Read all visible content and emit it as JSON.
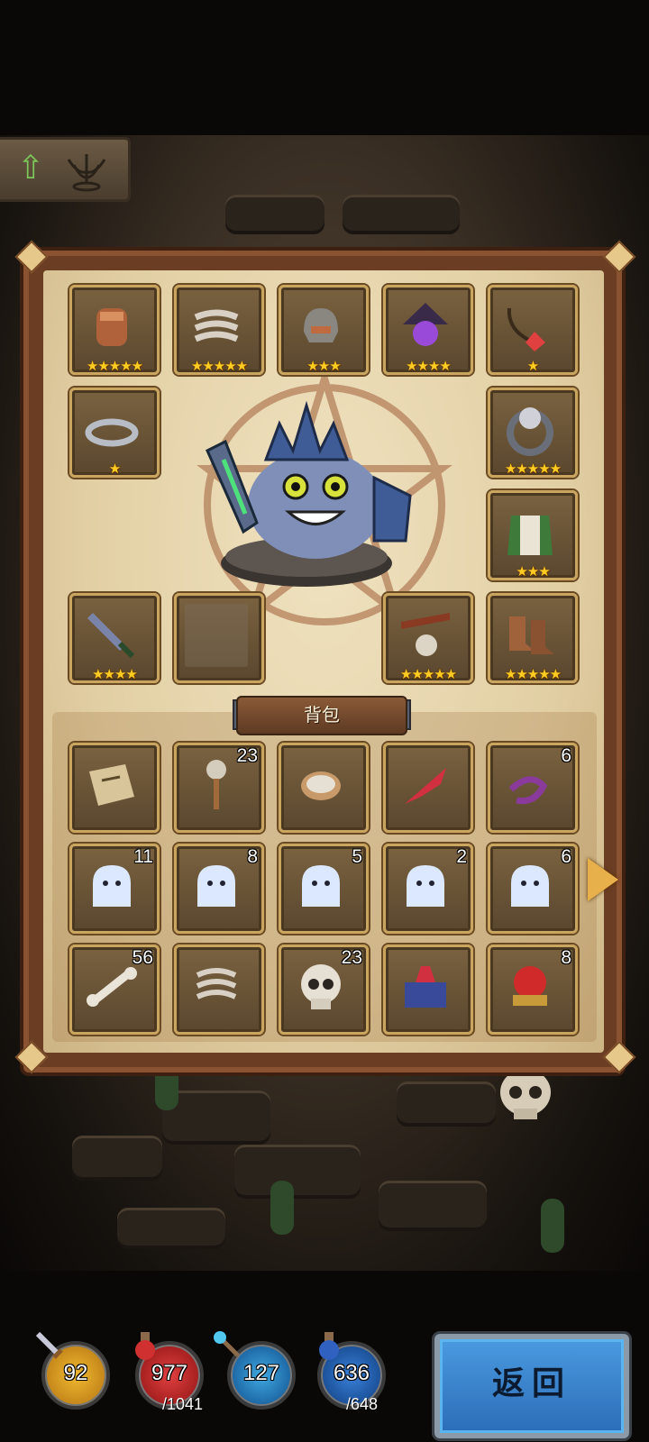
{
  "bag": {
    "title": "背包"
  },
  "equipment": [
    {
      "id": "gauntlet",
      "icon": "gauntlet-icon",
      "stars": 5
    },
    {
      "id": "bone-armor",
      "icon": "bone-armor-icon",
      "stars": 5
    },
    {
      "id": "bone-helm",
      "icon": "bone-helmet-icon",
      "stars": 3
    },
    {
      "id": "dark-lantern",
      "icon": "dark-lantern-icon",
      "stars": 4
    },
    {
      "id": "gem-necklace",
      "icon": "necklace-icon",
      "stars": 1
    },
    {
      "id": "silver-ring",
      "icon": "ring-icon",
      "stars": 1
    },
    {
      "id": "skull-ring",
      "icon": "skull-ring-icon",
      "stars": 5
    },
    {
      "id": "green-cloak",
      "icon": "cloak-icon",
      "stars": 3
    },
    {
      "id": "dagger",
      "icon": "dagger-icon",
      "stars": 4
    },
    {
      "id": "empty",
      "icon": "empty-slot-icon",
      "stars": 0
    },
    {
      "id": "skull-belt",
      "icon": "skull-belt-icon",
      "stars": 5
    },
    {
      "id": "boots",
      "icon": "boots-icon",
      "stars": 5
    }
  ],
  "inventory": [
    {
      "icon": "map-scroll-icon",
      "count": ""
    },
    {
      "icon": "skull-key-icon",
      "count": "23"
    },
    {
      "icon": "compass-icon",
      "count": ""
    },
    {
      "icon": "red-feather-icon",
      "count": ""
    },
    {
      "icon": "purple-rope-icon",
      "count": "6"
    },
    {
      "icon": "ghost-icon",
      "count": "11"
    },
    {
      "icon": "ghost-icon",
      "count": "8"
    },
    {
      "icon": "ghost-icon",
      "count": "5"
    },
    {
      "icon": "ghost-icon",
      "count": "2"
    },
    {
      "icon": "ghost-icon",
      "count": "6"
    },
    {
      "icon": "bone-icon",
      "count": "56"
    },
    {
      "icon": "ribcage-icon",
      "count": ""
    },
    {
      "icon": "skull-icon",
      "count": "23"
    },
    {
      "icon": "treasure-box-icon",
      "count": ""
    },
    {
      "icon": "red-potion-jar-icon",
      "count": "8"
    }
  ],
  "stats": {
    "attack": "92",
    "hp": "977",
    "hp_max": "/1041",
    "defense": "127",
    "mp": "636",
    "mp_max": "/648"
  },
  "back_button": "返回",
  "colors": {
    "star": "#ffcc22",
    "button": "#2c6db8",
    "frame": "#6b3d22"
  }
}
